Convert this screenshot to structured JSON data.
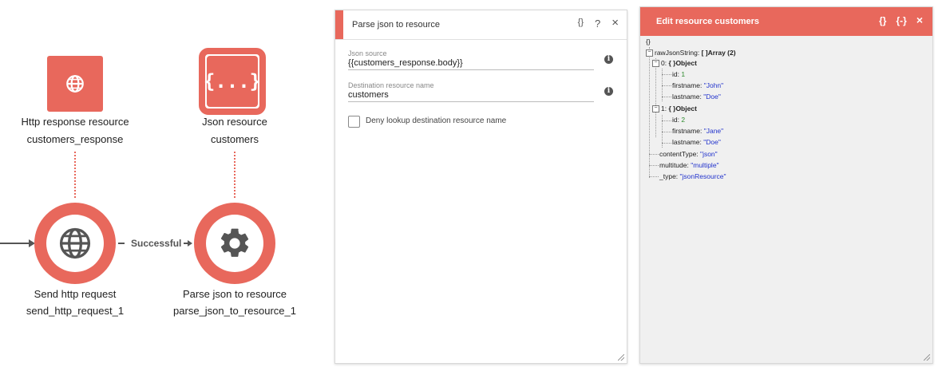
{
  "canvas": {
    "http_resource": {
      "title": "Http response resource",
      "name": "customers_response",
      "icon": "globe-icon"
    },
    "json_resource": {
      "title": "Json resource",
      "name": "customers",
      "icon": "curly-braces-icon",
      "glyph": "{...}"
    },
    "send_node": {
      "title": "Send http request",
      "name": "send_http_request_1",
      "icon": "globe-icon"
    },
    "parse_node": {
      "title": "Parse json to resource",
      "name": "parse_json_to_resource_1",
      "icon": "gear-icon"
    },
    "edge_label": "Successful",
    "accent_color": "#e8685c"
  },
  "parse_panel": {
    "title": "Parse json to resource",
    "tools": [
      "{}",
      "?",
      "×"
    ],
    "json_source_label": "Json source",
    "json_source_value": "{{customers_response.body}}",
    "destination_label": "Destination resource name",
    "destination_value": "customers",
    "checkbox_label": "Deny lookup destination resource name",
    "checkbox_checked": false
  },
  "edit_panel": {
    "title": "Edit resource customers",
    "tools": [
      "{}",
      "{-}",
      "×"
    ],
    "tree": {
      "root": "{}",
      "rawJsonString_key": "rawJsonString:",
      "rawJsonString_type": "[ ]Array (2)",
      "items": [
        {
          "index": "0:",
          "type": "{ }Object",
          "id": "1",
          "firstname": "\"John\"",
          "lastname": "\"Doe\""
        },
        {
          "index": "1:",
          "type": "{ }Object",
          "id": "2",
          "firstname": "\"Jane\"",
          "lastname": "\"Doe\""
        }
      ],
      "id_key": "id:",
      "firstname_key": "firstname:",
      "lastname_key": "lastname:",
      "contentType_key": "contentType:",
      "contentType_value": "\"json\"",
      "multitude_key": "multitude:",
      "multitude_value": "\"multiple\"",
      "type_key": "_type:",
      "type_value": "\"jsonResource\"",
      "minus": "−"
    }
  }
}
